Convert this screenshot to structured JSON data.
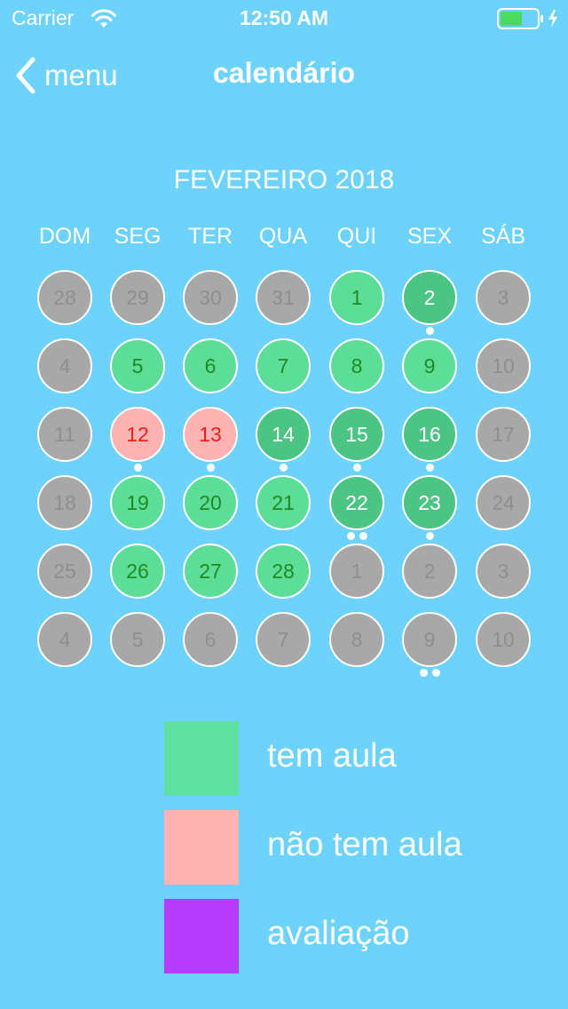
{
  "status_bar": {
    "carrier": "Carrier",
    "time": "12:50 AM",
    "wifi_icon": "wifi-icon",
    "battery_icon": "battery-charging-icon",
    "battery_level": 0.6
  },
  "nav": {
    "back_label": "menu",
    "back_icon": "chevron-left-icon",
    "title": "calendário"
  },
  "calendar": {
    "month_title": "FEVEREIRO 2018",
    "weekdays": [
      "DOM",
      "SEG",
      "TER",
      "QUA",
      "QUI",
      "SEX",
      "SÁB"
    ],
    "weeks": [
      [
        {
          "d": "28",
          "s": "gray",
          "dots": 0
        },
        {
          "d": "29",
          "s": "gray",
          "dots": 0
        },
        {
          "d": "30",
          "s": "gray",
          "dots": 0
        },
        {
          "d": "31",
          "s": "gray",
          "dots": 0
        },
        {
          "d": "1",
          "s": "green",
          "dots": 0
        },
        {
          "d": "2",
          "s": "dgreen",
          "dots": 1
        },
        {
          "d": "3",
          "s": "gray",
          "dots": 0
        }
      ],
      [
        {
          "d": "4",
          "s": "gray",
          "dots": 0
        },
        {
          "d": "5",
          "s": "green",
          "dots": 0
        },
        {
          "d": "6",
          "s": "green",
          "dots": 0
        },
        {
          "d": "7",
          "s": "green",
          "dots": 0
        },
        {
          "d": "8",
          "s": "green",
          "dots": 0
        },
        {
          "d": "9",
          "s": "green",
          "dots": 0
        },
        {
          "d": "10",
          "s": "gray",
          "dots": 0
        }
      ],
      [
        {
          "d": "11",
          "s": "gray",
          "dots": 0
        },
        {
          "d": "12",
          "s": "pink",
          "dots": 1
        },
        {
          "d": "13",
          "s": "pink",
          "dots": 1
        },
        {
          "d": "14",
          "s": "dgreen",
          "dots": 1
        },
        {
          "d": "15",
          "s": "dgreen",
          "dots": 1
        },
        {
          "d": "16",
          "s": "dgreen",
          "dots": 1
        },
        {
          "d": "17",
          "s": "gray",
          "dots": 0
        }
      ],
      [
        {
          "d": "18",
          "s": "gray",
          "dots": 0
        },
        {
          "d": "19",
          "s": "green",
          "dots": 0
        },
        {
          "d": "20",
          "s": "green",
          "dots": 0
        },
        {
          "d": "21",
          "s": "green",
          "dots": 0
        },
        {
          "d": "22",
          "s": "dgreen",
          "dots": 2
        },
        {
          "d": "23",
          "s": "dgreen",
          "dots": 1
        },
        {
          "d": "24",
          "s": "gray",
          "dots": 0
        }
      ],
      [
        {
          "d": "25",
          "s": "gray",
          "dots": 0
        },
        {
          "d": "26",
          "s": "green",
          "dots": 0
        },
        {
          "d": "27",
          "s": "green",
          "dots": 0
        },
        {
          "d": "28",
          "s": "green",
          "dots": 0
        },
        {
          "d": "1",
          "s": "gray",
          "dots": 0
        },
        {
          "d": "2",
          "s": "gray",
          "dots": 0
        },
        {
          "d": "3",
          "s": "gray",
          "dots": 0
        }
      ],
      [
        {
          "d": "4",
          "s": "gray",
          "dots": 0
        },
        {
          "d": "5",
          "s": "gray",
          "dots": 0
        },
        {
          "d": "6",
          "s": "gray",
          "dots": 0
        },
        {
          "d": "7",
          "s": "gray",
          "dots": 0
        },
        {
          "d": "8",
          "s": "gray",
          "dots": 0
        },
        {
          "d": "9",
          "s": "gray",
          "dots": 2
        },
        {
          "d": "10",
          "s": "gray",
          "dots": 0
        }
      ]
    ]
  },
  "legend": [
    {
      "label": "tem aula",
      "color": "#5fe0a0"
    },
    {
      "label": "não tem aula",
      "color": "#ffb3b3"
    },
    {
      "label": "avaliação",
      "color": "#b83cff"
    }
  ]
}
